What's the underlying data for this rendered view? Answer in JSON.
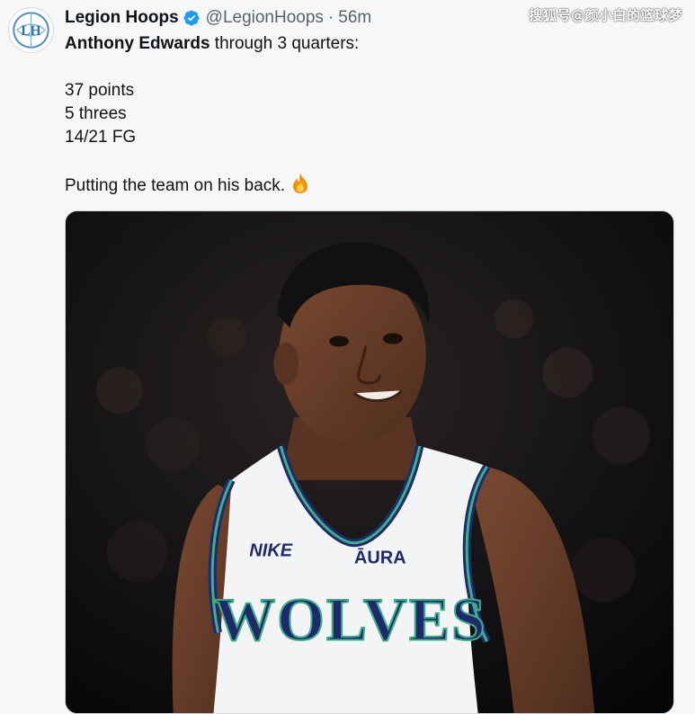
{
  "tweet": {
    "author_name": "Legion Hoops",
    "handle": "@LegionHoops",
    "separator": "·",
    "time": "56m",
    "avatar_initials": "LH",
    "subject_name": "Anthony Edwards",
    "intro_rest": " through 3 quarters:",
    "stats": [
      "37 points",
      "5 threes",
      "14/21 FG"
    ],
    "closing": "Putting the team on his back.",
    "closing_emoji": "fire-emoji-icon"
  },
  "photo": {
    "jersey_brand": "NIKE",
    "jersey_sponsor": "ĀURA",
    "jersey_team": "WOLVES"
  },
  "watermark": "搜狐号@颜小白的篮球梦",
  "colors": {
    "verified_blue": "#1d9bf0",
    "muted_text": "#536471",
    "jersey_navy": "#1f2a6b",
    "jersey_green": "#3fae8a"
  }
}
